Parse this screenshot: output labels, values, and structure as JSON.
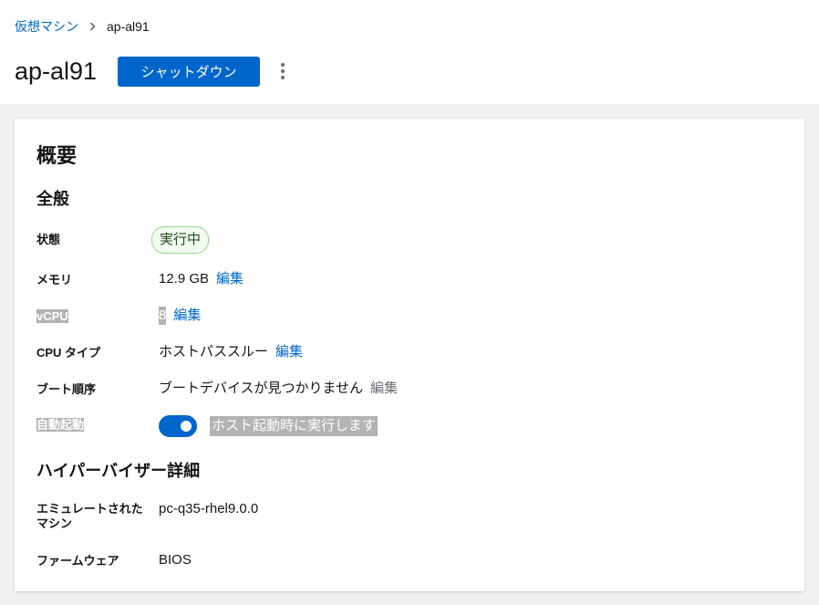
{
  "breadcrumb": {
    "parent": "仮想マシン",
    "current": "ap-al91"
  },
  "header": {
    "title": "ap-al91",
    "shutdown_label": "シャットダウン"
  },
  "card": {
    "title": "概要",
    "general": {
      "title": "全般",
      "status_label": "状態",
      "status_value": "実行中",
      "memory_label": "メモリ",
      "memory_value": "12.9 GB",
      "memory_edit": "編集",
      "vcpu_label": "vCPU",
      "vcpu_value": "8",
      "vcpu_edit": "編集",
      "cpu_type_label": "CPU タイプ",
      "cpu_type_value": "ホストパススルー",
      "cpu_type_edit": "編集",
      "boot_order_label": "ブート順序",
      "boot_order_value": "ブートデバイスが見つかりません",
      "boot_order_edit": "編集",
      "autostart_label": "自動起動",
      "autostart_on": true,
      "autostart_text": "ホスト起動時に実行します"
    },
    "hypervisor": {
      "title": "ハイパーバイザー詳細",
      "emulated_label_1": "エミュレートされた",
      "emulated_label_2": "マシン",
      "emulated_value": "pc-q35-rhel9.0.0",
      "firmware_label": "ファームウェア",
      "firmware_value": "BIOS"
    }
  },
  "colors": {
    "accent": "#0066cc",
    "status_border": "#95d58e",
    "status_bg": "#f3faf2",
    "selection": "#b3b3b3"
  },
  "icons": {
    "breadcrumb_separator": "chevron-right-icon",
    "kebab": "kebab-menu-icon"
  }
}
